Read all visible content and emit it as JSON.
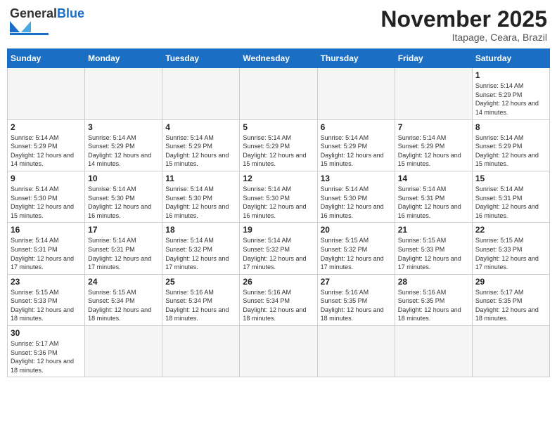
{
  "logo": {
    "text_general": "General",
    "text_blue": "Blue"
  },
  "title": {
    "month_year": "November 2025",
    "location": "Itapage, Ceara, Brazil"
  },
  "weekdays": [
    "Sunday",
    "Monday",
    "Tuesday",
    "Wednesday",
    "Thursday",
    "Friday",
    "Saturday"
  ],
  "weeks": [
    [
      {
        "day": "",
        "empty": true
      },
      {
        "day": "",
        "empty": true
      },
      {
        "day": "",
        "empty": true
      },
      {
        "day": "",
        "empty": true
      },
      {
        "day": "",
        "empty": true
      },
      {
        "day": "",
        "empty": true
      },
      {
        "day": "1",
        "sunrise": "5:14 AM",
        "sunset": "5:29 PM",
        "daylight": "12 hours and 14 minutes."
      }
    ],
    [
      {
        "day": "2",
        "sunrise": "5:14 AM",
        "sunset": "5:29 PM",
        "daylight": "12 hours and 14 minutes."
      },
      {
        "day": "3",
        "sunrise": "5:14 AM",
        "sunset": "5:29 PM",
        "daylight": "12 hours and 14 minutes."
      },
      {
        "day": "4",
        "sunrise": "5:14 AM",
        "sunset": "5:29 PM",
        "daylight": "12 hours and 15 minutes."
      },
      {
        "day": "5",
        "sunrise": "5:14 AM",
        "sunset": "5:29 PM",
        "daylight": "12 hours and 15 minutes."
      },
      {
        "day": "6",
        "sunrise": "5:14 AM",
        "sunset": "5:29 PM",
        "daylight": "12 hours and 15 minutes."
      },
      {
        "day": "7",
        "sunrise": "5:14 AM",
        "sunset": "5:29 PM",
        "daylight": "12 hours and 15 minutes."
      },
      {
        "day": "8",
        "sunrise": "5:14 AM",
        "sunset": "5:29 PM",
        "daylight": "12 hours and 15 minutes."
      }
    ],
    [
      {
        "day": "9",
        "sunrise": "5:14 AM",
        "sunset": "5:30 PM",
        "daylight": "12 hours and 15 minutes."
      },
      {
        "day": "10",
        "sunrise": "5:14 AM",
        "sunset": "5:30 PM",
        "daylight": "12 hours and 16 minutes."
      },
      {
        "day": "11",
        "sunrise": "5:14 AM",
        "sunset": "5:30 PM",
        "daylight": "12 hours and 16 minutes."
      },
      {
        "day": "12",
        "sunrise": "5:14 AM",
        "sunset": "5:30 PM",
        "daylight": "12 hours and 16 minutes."
      },
      {
        "day": "13",
        "sunrise": "5:14 AM",
        "sunset": "5:30 PM",
        "daylight": "12 hours and 16 minutes."
      },
      {
        "day": "14",
        "sunrise": "5:14 AM",
        "sunset": "5:31 PM",
        "daylight": "12 hours and 16 minutes."
      },
      {
        "day": "15",
        "sunrise": "5:14 AM",
        "sunset": "5:31 PM",
        "daylight": "12 hours and 16 minutes."
      }
    ],
    [
      {
        "day": "16",
        "sunrise": "5:14 AM",
        "sunset": "5:31 PM",
        "daylight": "12 hours and 17 minutes."
      },
      {
        "day": "17",
        "sunrise": "5:14 AM",
        "sunset": "5:31 PM",
        "daylight": "12 hours and 17 minutes."
      },
      {
        "day": "18",
        "sunrise": "5:14 AM",
        "sunset": "5:32 PM",
        "daylight": "12 hours and 17 minutes."
      },
      {
        "day": "19",
        "sunrise": "5:14 AM",
        "sunset": "5:32 PM",
        "daylight": "12 hours and 17 minutes."
      },
      {
        "day": "20",
        "sunrise": "5:15 AM",
        "sunset": "5:32 PM",
        "daylight": "12 hours and 17 minutes."
      },
      {
        "day": "21",
        "sunrise": "5:15 AM",
        "sunset": "5:33 PM",
        "daylight": "12 hours and 17 minutes."
      },
      {
        "day": "22",
        "sunrise": "5:15 AM",
        "sunset": "5:33 PM",
        "daylight": "12 hours and 17 minutes."
      }
    ],
    [
      {
        "day": "23",
        "sunrise": "5:15 AM",
        "sunset": "5:33 PM",
        "daylight": "12 hours and 18 minutes."
      },
      {
        "day": "24",
        "sunrise": "5:15 AM",
        "sunset": "5:34 PM",
        "daylight": "12 hours and 18 minutes."
      },
      {
        "day": "25",
        "sunrise": "5:16 AM",
        "sunset": "5:34 PM",
        "daylight": "12 hours and 18 minutes."
      },
      {
        "day": "26",
        "sunrise": "5:16 AM",
        "sunset": "5:34 PM",
        "daylight": "12 hours and 18 minutes."
      },
      {
        "day": "27",
        "sunrise": "5:16 AM",
        "sunset": "5:35 PM",
        "daylight": "12 hours and 18 minutes."
      },
      {
        "day": "28",
        "sunrise": "5:16 AM",
        "sunset": "5:35 PM",
        "daylight": "12 hours and 18 minutes."
      },
      {
        "day": "29",
        "sunrise": "5:17 AM",
        "sunset": "5:35 PM",
        "daylight": "12 hours and 18 minutes."
      }
    ],
    [
      {
        "day": "30",
        "sunrise": "5:17 AM",
        "sunset": "5:36 PM",
        "daylight": "12 hours and 18 minutes."
      },
      {
        "day": "",
        "empty": true
      },
      {
        "day": "",
        "empty": true
      },
      {
        "day": "",
        "empty": true
      },
      {
        "day": "",
        "empty": true
      },
      {
        "day": "",
        "empty": true
      },
      {
        "day": "",
        "empty": true
      }
    ]
  ]
}
